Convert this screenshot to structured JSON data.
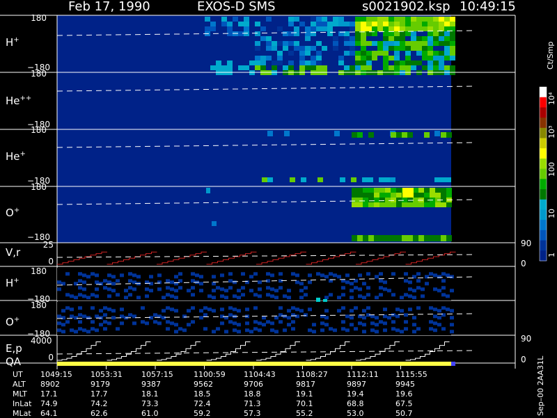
{
  "header": {
    "date": "Feb 17, 1990",
    "instrument": "EXOS-D SMS",
    "file": "s0021902.ksp",
    "time": "10:49:15"
  },
  "panels": [
    {
      "label": "H",
      "sup": "+",
      "ymax": "180",
      "ymin": "−180"
    },
    {
      "label": "He",
      "sup": "++",
      "ymax": "180",
      "ymin": "−180"
    },
    {
      "label": "He",
      "sup": "+",
      "ymax": "180",
      "ymin": "−180"
    },
    {
      "label": "O",
      "sup": "+",
      "ymax": "180",
      "ymin": "−180"
    }
  ],
  "vr_panel": {
    "label": "V,r",
    "ymax": "25",
    "ymin": "0",
    "right_top": "90",
    "right_bottom": "0"
  },
  "small_panels": [
    {
      "label": "H",
      "sup": "+",
      "ymax": "180",
      "ymin": "−180"
    },
    {
      "label": "O",
      "sup": "+",
      "ymax": "180",
      "ymin": "−180"
    }
  ],
  "ep_panel": {
    "label": "E,p",
    "ymax": "4000",
    "ymin": "0",
    "right_top": "90",
    "right_bottom": "0",
    "qa_label": "QA"
  },
  "colorbar": {
    "unit": "Ct/Smp",
    "tick_labels": [
      "10⁴",
      "10³",
      "100",
      "10",
      "1"
    ],
    "colors": [
      "#ffffff",
      "#ff0000",
      "#aa0000",
      "#883300",
      "#888800",
      "#cccc00",
      "#ffff00",
      "#99dd00",
      "#66cc00",
      "#00aa00",
      "#007700",
      "#00aacc",
      "#0099cc",
      "#0077cc",
      "#0055bb",
      "#003399",
      "#002288"
    ]
  },
  "table": {
    "row_labels": [
      "UT",
      "ALT",
      "MLT",
      "InLat",
      "MLat"
    ],
    "columns": [
      [
        "1049:15",
        "8902",
        "17.1",
        "74.9",
        "64.1"
      ],
      [
        "1053:31",
        "9179",
        "17.7",
        "74.2",
        "62.6"
      ],
      [
        "1057:15",
        "9387",
        "18.1",
        "73.3",
        "61.0"
      ],
      [
        "1100:59",
        "9562",
        "18.5",
        "72.4",
        "59.2"
      ],
      [
        "1104:43",
        "9706",
        "18.8",
        "71.3",
        "57.3"
      ],
      [
        "1108:27",
        "9817",
        "19.1",
        "70.1",
        "55.2"
      ],
      [
        "1112:11",
        "9897",
        "19.4",
        "68.8",
        "53.0"
      ],
      [
        "1115:55",
        "9945",
        "19.6",
        "67.5",
        "50.7"
      ]
    ]
  },
  "footer_vertical": "Sep–00 2AA31L",
  "chart_data": {
    "type": "heatmap",
    "title": "Feb 17, 1990 EXOS-D SMS s0021902.ksp 10:49:15",
    "x_ticks": [
      "1049:15",
      "1053:31",
      "1057:15",
      "1100:59",
      "1104:43",
      "1108:27",
      "1112:11",
      "1115:55"
    ],
    "x_ticks_2": [
      "1049:15",
      "1053:31",
      "1057:15",
      "1100:59",
      "1104:43",
      "1108:27",
      "1112:11",
      "1115:55"
    ],
    "series": [
      {
        "name": "H+",
        "ylim": [
          -180,
          180
        ]
      },
      {
        "name": "He++",
        "ylim": [
          -180,
          180
        ]
      },
      {
        "name": "He+",
        "ylim": [
          -180,
          180
        ]
      },
      {
        "name": "O+",
        "ylim": [
          -180,
          180
        ]
      },
      {
        "name": "V,r",
        "ylim": [
          0,
          25
        ],
        "right_ylim": [
          0,
          90
        ]
      },
      {
        "name": "H+",
        "ylim": [
          -180,
          180
        ]
      },
      {
        "name": "O+",
        "ylim": [
          -180,
          180
        ]
      },
      {
        "name": "E,p",
        "ylim": [
          0,
          4000
        ],
        "right_ylim": [
          0,
          90
        ]
      }
    ],
    "colorbar": {
      "label": "Ct/Smp",
      "scale": "log",
      "range": [
        1,
        10000
      ]
    }
  }
}
